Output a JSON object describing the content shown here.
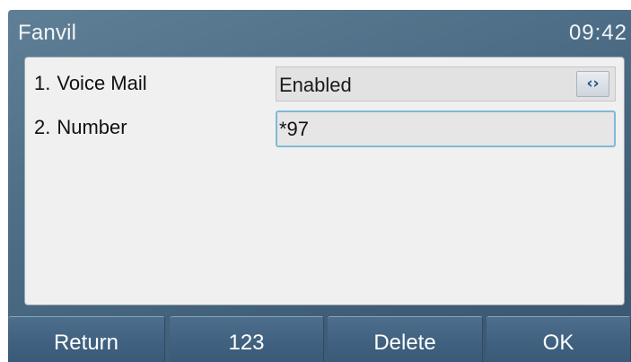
{
  "status_bar": {
    "brand": "Fanvil",
    "time": "09:42"
  },
  "menu": {
    "items": [
      {
        "index": "1.",
        "label": "Voice Mail",
        "control": "select",
        "value": "Enabled",
        "icon": "left-right-arrows-icon"
      },
      {
        "index": "2.",
        "label": "Number",
        "control": "input",
        "value": "*97"
      }
    ]
  },
  "softkeys": [
    {
      "label": "Return"
    },
    {
      "label": "123"
    },
    {
      "label": "Delete"
    },
    {
      "label": "OK"
    }
  ],
  "colors": {
    "screen_bg": "#4d6d86",
    "content_bg": "#f0f0f0",
    "input_focus_border": "#7fb9d6",
    "arrow_color": "#1f4e8a",
    "softkey_text": "#ffffff"
  }
}
